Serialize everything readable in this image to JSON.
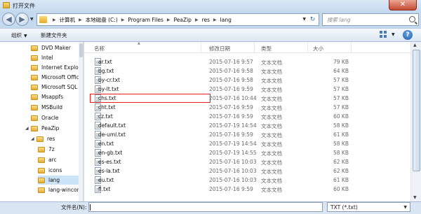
{
  "window": {
    "title": "打开文件",
    "close_label": "✕"
  },
  "address": {
    "segments": [
      "计算机",
      "本地磁盘 (C:)",
      "Program Files",
      "PeaZip",
      "res",
      "lang"
    ],
    "search_placeholder": "搜索 lang"
  },
  "toolbar": {
    "organize_label": "组织",
    "new_folder_label": "新建文件夹",
    "help_label": "?"
  },
  "nav": {
    "items": [
      {
        "label": "DVD Maker"
      },
      {
        "label": "Intel"
      },
      {
        "label": "Internet Explore"
      },
      {
        "label": "Microsoft Office"
      },
      {
        "label": "Microsoft SQL S"
      },
      {
        "label": "Msappfs"
      },
      {
        "label": "MSBuild"
      },
      {
        "label": "Oracle"
      },
      {
        "label": "PeaZip"
      },
      {
        "label": "res"
      },
      {
        "label": "7z"
      },
      {
        "label": "arc"
      },
      {
        "label": "icons"
      },
      {
        "label": "lang",
        "selected": true
      },
      {
        "label": "lang-wincon"
      }
    ]
  },
  "columns": {
    "name": "名称",
    "date": "修改日期",
    "type": "类型",
    "size": "大小"
  },
  "files": [
    {
      "name": "ar.txt",
      "date": "2015-07-16 9:57",
      "type": "文本文档",
      "size": "79 KB"
    },
    {
      "name": "bg.txt",
      "date": "2015-07-16 9:58",
      "type": "文本文档",
      "size": "64 KB"
    },
    {
      "name": "by-cr.txt",
      "date": "2015-07-16 9:58",
      "type": "文本文档",
      "size": "57 KB"
    },
    {
      "name": "by-lt.txt",
      "date": "2015-07-16 9:59",
      "type": "文本文档",
      "size": "57 KB"
    },
    {
      "name": "chs.txt",
      "date": "2015-07-16 10:44",
      "type": "文本文档",
      "size": "57 KB",
      "highlighted": true
    },
    {
      "name": "cht.txt",
      "date": "2015-07-16 9:59",
      "type": "文本文档",
      "size": "57 KB"
    },
    {
      "name": "cz.txt",
      "date": "2015-07-16 9:59",
      "type": "文本文档",
      "size": "60 KB"
    },
    {
      "name": "default.txt",
      "date": "2015-07-19 14:54",
      "type": "文本文档",
      "size": "58 KB"
    },
    {
      "name": "de-uml.txt",
      "date": "2015-07-16 9:59",
      "type": "文本文档",
      "size": "61 KB"
    },
    {
      "name": "en.txt",
      "date": "2015-07-19 14:54",
      "type": "文本文档",
      "size": "58 KB"
    },
    {
      "name": "en-gb.txt",
      "date": "2015-07-19 14:55",
      "type": "文本文档",
      "size": "58 KB"
    },
    {
      "name": "es-es.txt",
      "date": "2015-07-16 10:03",
      "type": "文本文档",
      "size": "62 KB"
    },
    {
      "name": "es-la.txt",
      "date": "2015-07-16 10:03",
      "type": "文本文档",
      "size": "62 KB"
    },
    {
      "name": "eu.txt",
      "date": "2015-07-16 10:03",
      "type": "文本文档",
      "size": "61 KB"
    },
    {
      "name": "fi.txt",
      "date": "2015-07-16 9:59",
      "type": "文本文档",
      "size": "60 KB"
    }
  ],
  "bottom": {
    "filename_label": "文件名(N):",
    "filename_value": "",
    "filetype_value": "TXT (*.txt)"
  }
}
